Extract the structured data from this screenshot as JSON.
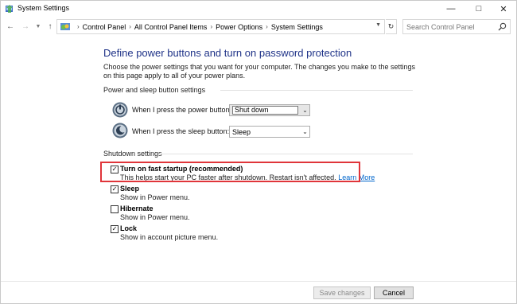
{
  "window": {
    "title": "System Settings"
  },
  "address": {
    "breadcrumbs": [
      "Control Panel",
      "All Control Panel Items",
      "Power Options",
      "System Settings"
    ],
    "search_placeholder": "Search Control Panel"
  },
  "main": {
    "heading": "Define power buttons and turn on password protection",
    "description": "Choose the power settings that you want for your computer. The changes you make to the settings on this page apply to all of your power plans.",
    "power_sleep_group": {
      "label": "Power and sleep button settings",
      "rows": [
        {
          "label": "When I press the power button:",
          "value": "Shut down",
          "icon": "power-icon"
        },
        {
          "label": "When I press the sleep button:",
          "value": "Sleep",
          "icon": "sleep-icon"
        }
      ]
    },
    "shutdown_group": {
      "label": "Shutdown settings",
      "options": [
        {
          "title": "Turn on fast startup (recommended)",
          "description": "This helps start your PC faster after shutdown. Restart isn't affected.",
          "link": "Learn More",
          "checked": true
        },
        {
          "title": "Sleep",
          "description": "Show in Power menu.",
          "checked": true
        },
        {
          "title": "Hibernate",
          "description": "Show in Power menu.",
          "checked": false
        },
        {
          "title": "Lock",
          "description": "Show in account picture menu.",
          "checked": true
        }
      ]
    }
  },
  "footer": {
    "save_label": "Save changes",
    "cancel_label": "Cancel"
  },
  "colors": {
    "heading": "#1e3287",
    "highlight": "#e0353a",
    "link": "#0066cc"
  }
}
